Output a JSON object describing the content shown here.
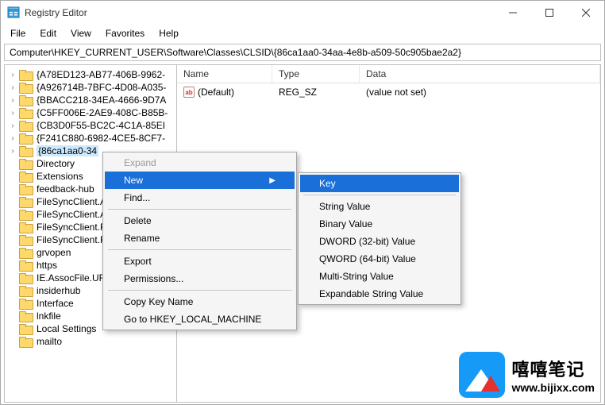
{
  "window": {
    "title": "Registry Editor"
  },
  "menu": {
    "file": "File",
    "edit": "Edit",
    "view": "View",
    "favorites": "Favorites",
    "help": "Help"
  },
  "path": "Computer\\HKEY_CURRENT_USER\\Software\\Classes\\CLSID\\{86ca1aa0-34aa-4e8b-a509-50c905bae2a2}",
  "list": {
    "headers": {
      "name": "Name",
      "type": "Type",
      "data": "Data"
    },
    "rows": [
      {
        "name": "(Default)",
        "type": "REG_SZ",
        "data": "(value not set)"
      }
    ]
  },
  "tree": {
    "items": [
      {
        "label": "{A78ED123-AB77-406B-9962-",
        "level": 1,
        "chevron": true
      },
      {
        "label": "{A926714B-7BFC-4D08-A035-",
        "level": 1,
        "chevron": true
      },
      {
        "label": "{BBACC218-34EA-4666-9D7A",
        "level": 1,
        "chevron": true
      },
      {
        "label": "{C5FF006E-2AE9-408C-B85B-",
        "level": 1,
        "chevron": true
      },
      {
        "label": "{CB3D0F55-BC2C-4C1A-85EI",
        "level": 1,
        "chevron": true
      },
      {
        "label": "{F241C880-6982-4CE5-8CF7-",
        "level": 1,
        "chevron": true
      },
      {
        "label": "{86ca1aa0-34",
        "level": 1,
        "chevron": true,
        "selected": true
      },
      {
        "label": "Directory",
        "level": 0
      },
      {
        "label": "Extensions",
        "level": 0
      },
      {
        "label": "feedback-hub",
        "level": 0
      },
      {
        "label": "FileSyncClient.A",
        "level": 0
      },
      {
        "label": "FileSyncClient.A",
        "level": 0
      },
      {
        "label": "FileSyncClient.Fi",
        "level": 0
      },
      {
        "label": "FileSyncClient.Fi",
        "level": 0
      },
      {
        "label": "grvopen",
        "level": 0
      },
      {
        "label": "https",
        "level": 0
      },
      {
        "label": "IE.AssocFile.URL",
        "level": 0
      },
      {
        "label": "insiderhub",
        "level": 0
      },
      {
        "label": "Interface",
        "level": 0
      },
      {
        "label": "lnkfile",
        "level": 0
      },
      {
        "label": "Local Settings",
        "level": 0
      },
      {
        "label": "mailto",
        "level": 0
      }
    ]
  },
  "context_main": {
    "expand": "Expand",
    "new": "New",
    "find": "Find...",
    "delete": "Delete",
    "rename": "Rename",
    "export": "Export",
    "permissions": "Permissions...",
    "copykey": "Copy Key Name",
    "goto_hklm": "Go to HKEY_LOCAL_MACHINE"
  },
  "context_new": {
    "key": "Key",
    "string": "String Value",
    "binary": "Binary Value",
    "dword": "DWORD (32-bit) Value",
    "qword": "QWORD (64-bit) Value",
    "multi": "Multi-String Value",
    "expand": "Expandable String Value"
  },
  "watermark": {
    "line1": "嘻嘻笔记",
    "line2": "www.bijixx.com"
  }
}
